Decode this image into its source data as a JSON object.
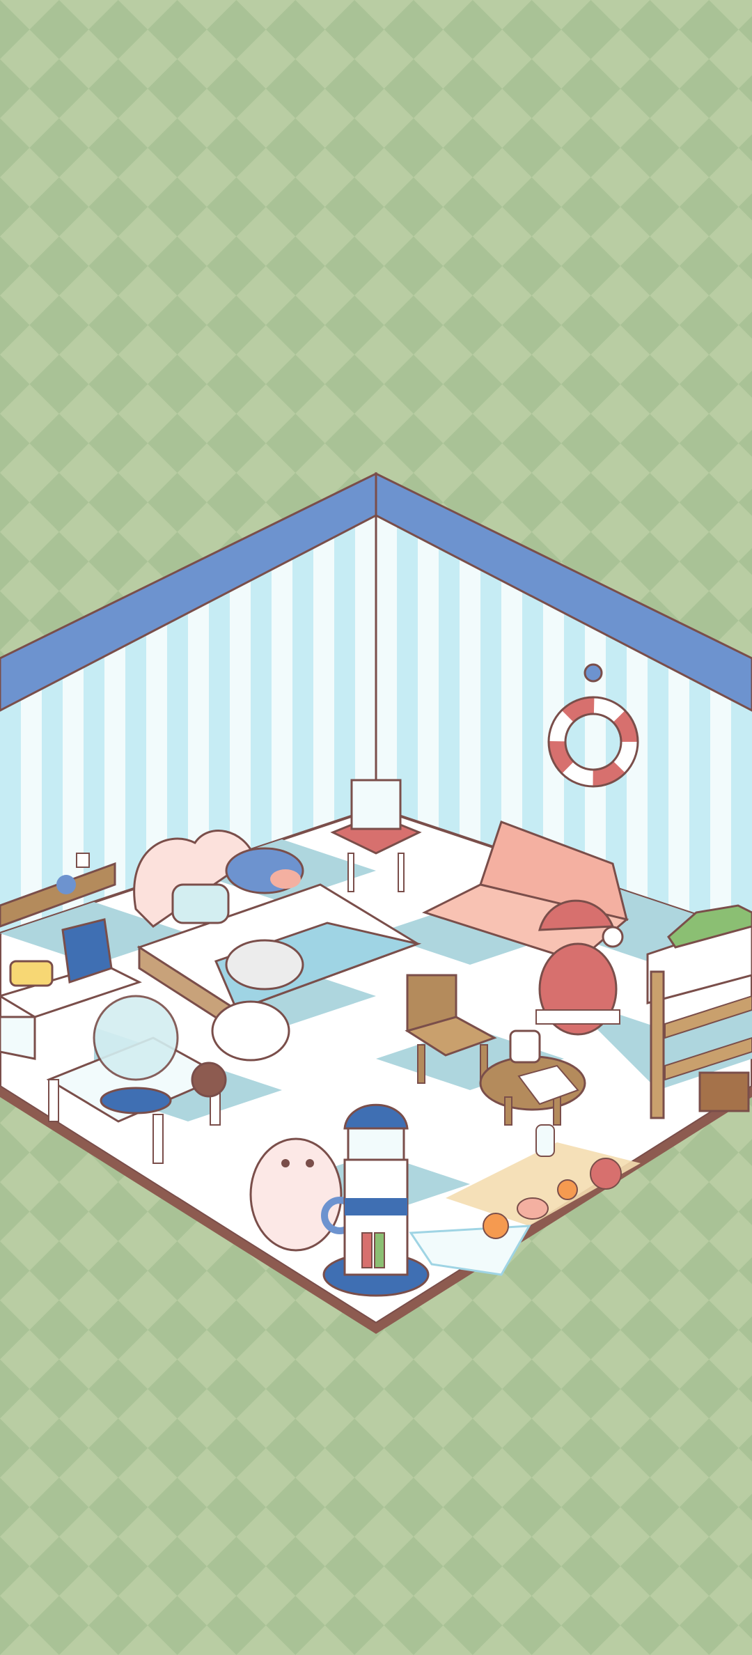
{
  "scene": {
    "type": "isometric-room",
    "theme": "ocean"
  },
  "colors": {
    "background_light": "#b9cda3",
    "background_dark": "#a9c296",
    "wall_stripe_light": "#f2fbfc",
    "wall_stripe_blue": "#c6ecf4",
    "wall_trim": "#6d93cf",
    "outline": "#7a4e4a",
    "floor_white": "#ffffff",
    "floor_blue": "#aed6de",
    "cushion_pink": "#f4b0a1",
    "santa_red": "#d7706e",
    "wood": "#b48b5c",
    "lighthouse_blue": "#3f6fb3"
  },
  "furniture": [
    {
      "name": "shell-bed",
      "icon": "bed-icon"
    },
    {
      "name": "pillow-sofa",
      "icon": "sofa-icon"
    },
    {
      "name": "lantern-stool",
      "icon": "lantern-icon"
    },
    {
      "name": "life-ring",
      "icon": "life-ring-icon"
    },
    {
      "name": "wall-shelf",
      "icon": "shelf-icon"
    },
    {
      "name": "side-table",
      "icon": "table-icon"
    },
    {
      "name": "wooden-chair",
      "icon": "chair-icon"
    },
    {
      "name": "tea-table",
      "icon": "tea-table-icon"
    },
    {
      "name": "fishbowl-stand",
      "icon": "fishbowl-icon"
    },
    {
      "name": "lighthouse-bookshelf",
      "icon": "lighthouse-icon"
    },
    {
      "name": "plant-bookshelf",
      "icon": "bookshelf-icon"
    },
    {
      "name": "beach-rug",
      "icon": "starfish-icon"
    }
  ],
  "pets": [
    {
      "name": "chef-hat-pet",
      "icon": "pet-icon"
    },
    {
      "name": "santa-pet",
      "icon": "pet-icon"
    },
    {
      "name": "pink-hamster",
      "icon": "hamster-icon"
    },
    {
      "name": "shark-plush",
      "icon": "shark-icon"
    }
  ]
}
